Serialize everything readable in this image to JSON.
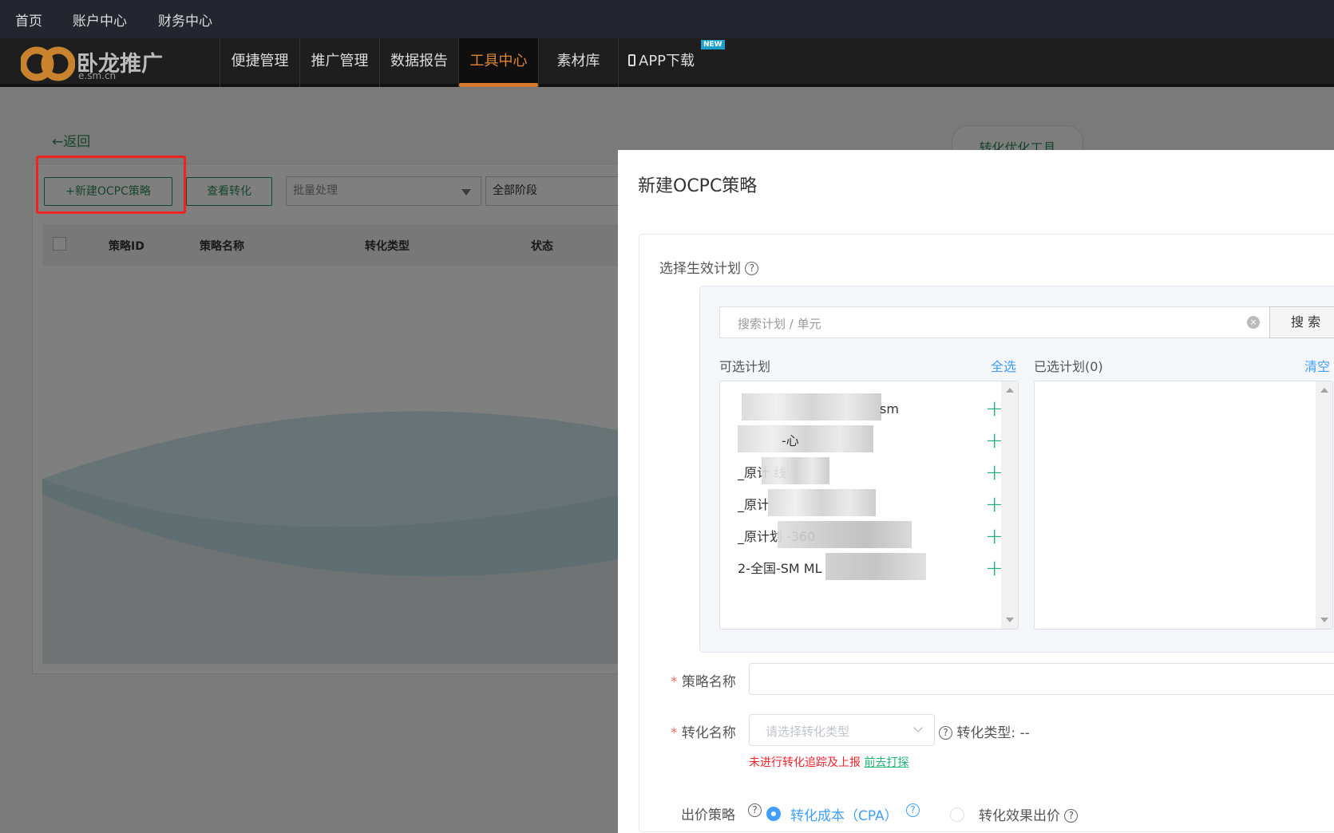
{
  "topbar": {
    "items": [
      "首页",
      "账户中心",
      "财务中心"
    ]
  },
  "nav": {
    "logo_text": "卧龙推广",
    "logo_sub": "e.sm.cn",
    "items": [
      "便捷管理",
      "推广管理",
      "数据报告",
      "工具中心",
      "素材库",
      "APP下载"
    ],
    "active": "工具中心",
    "new_badge": "NEW"
  },
  "page": {
    "back": "←返回",
    "tab": "转化优化工具",
    "new_button": "+新建OCPC策略",
    "view_button": "查看转化",
    "batch_select": "批量处理",
    "stage_select": "全部阶段",
    "table_headers": [
      "策略ID",
      "策略名称",
      "转化类型",
      "状态"
    ]
  },
  "modal": {
    "title": "新建OCPC策略",
    "plan_label": "选择生效计划",
    "search_placeholder": "搜索计划 / 单元",
    "search_button": "搜 索",
    "available_label": "可选计划",
    "select_all": "全选",
    "selected_label": "已选计划(0)",
    "clear": "清空",
    "available_items": [
      "sm",
      "-心",
      "_原计 线",
      "_原计",
      "_原计划 -360",
      "2-全国-SM ML"
    ],
    "name_label": "策略名称",
    "name_value": "",
    "conv_label": "转化名称",
    "conv_placeholder": "请选择转化类型",
    "conv_type_label": "转化类型:",
    "conv_type_value": "--",
    "error_text": "未进行转化追踪及上报",
    "error_link": "前去打探",
    "bid_label": "出价策略",
    "bid_options": [
      {
        "label": "转化成本（CPA）",
        "selected": true
      },
      {
        "label": "转化效果出价",
        "selected": false
      }
    ]
  },
  "colors": {
    "accent": "#2e8b57",
    "active_nav": "#e0853a",
    "link_blue": "#409eff",
    "plus_green": "#21b574",
    "error": "#f5222d",
    "highlight": "#f0231e"
  }
}
